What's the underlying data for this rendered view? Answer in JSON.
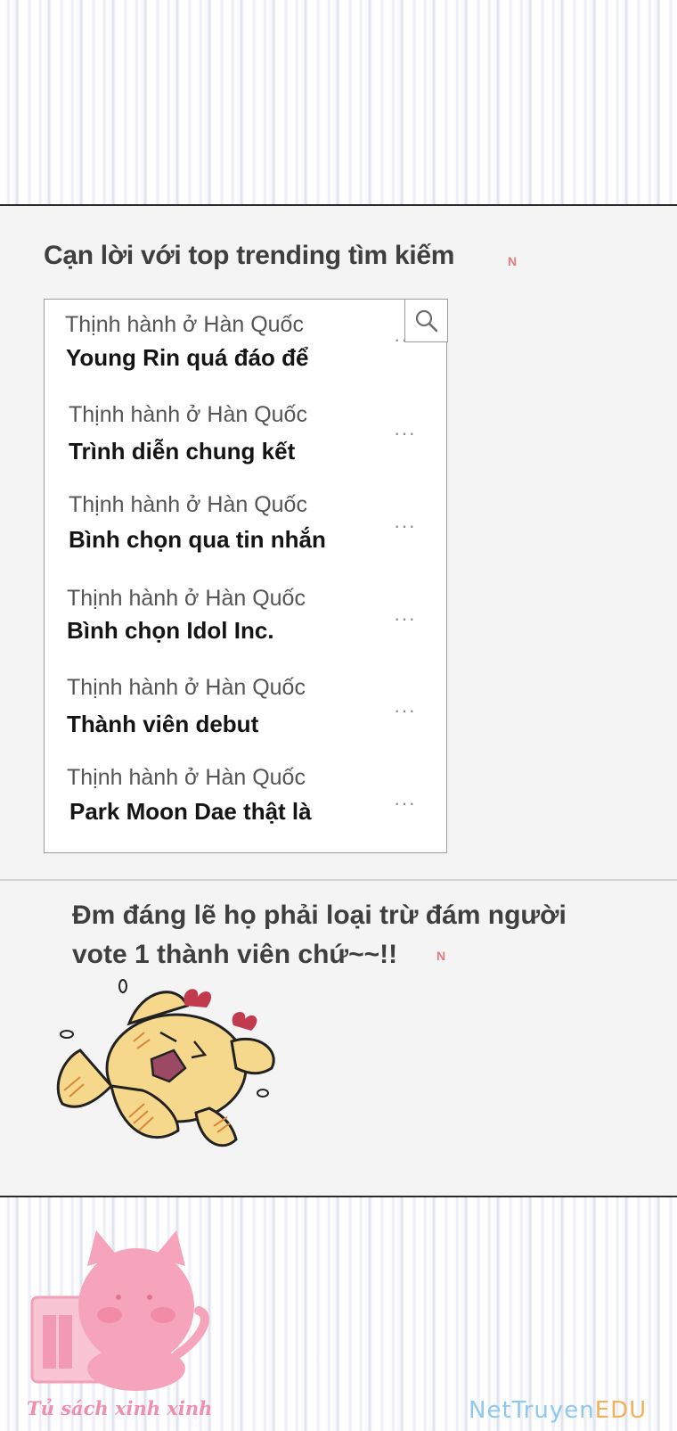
{
  "heading": "Cạn lời với top trending tìm kiếm",
  "n_mark": "N",
  "trending": {
    "items": [
      {
        "subtitle": "Thịnh hành ở Hàn Quốc",
        "title": "Young Rin quá đáo để",
        "more": "···"
      },
      {
        "subtitle": "Thịnh hành ở Hàn Quốc",
        "title": "Trình diễn chung kết",
        "more": "···"
      },
      {
        "subtitle": "Thịnh hành ở Hàn Quốc",
        "title": "Bình chọn qua tin nhắn",
        "more": "···"
      },
      {
        "subtitle": "Thịnh hành ở Hàn Quốc",
        "title": "Bình chọn Idol Inc.",
        "more": "···"
      },
      {
        "subtitle": "Thịnh hành ở Hàn Quốc",
        "title": "Thành viên debut",
        "more": "···"
      },
      {
        "subtitle": "Thịnh hành ở Hàn Quốc",
        "title": "Park Moon Dae thật là",
        "more": "···"
      }
    ],
    "search_icon": "search-icon"
  },
  "comment": {
    "line1": "Đm đáng lẽ họ phải loại trừ đám người",
    "line2": "vote 1 thành viên chứ~~!!"
  },
  "logo_text": "Tủ sách xinh xinh",
  "watermark": {
    "part1": "NetTruyen",
    "part2": "EDU"
  },
  "colors": {
    "accent_pink": "#ef8fb0",
    "n_mark": "#e37c7c",
    "watermark_blue": "#8ec8ee",
    "watermark_orange": "#f2b15b"
  }
}
